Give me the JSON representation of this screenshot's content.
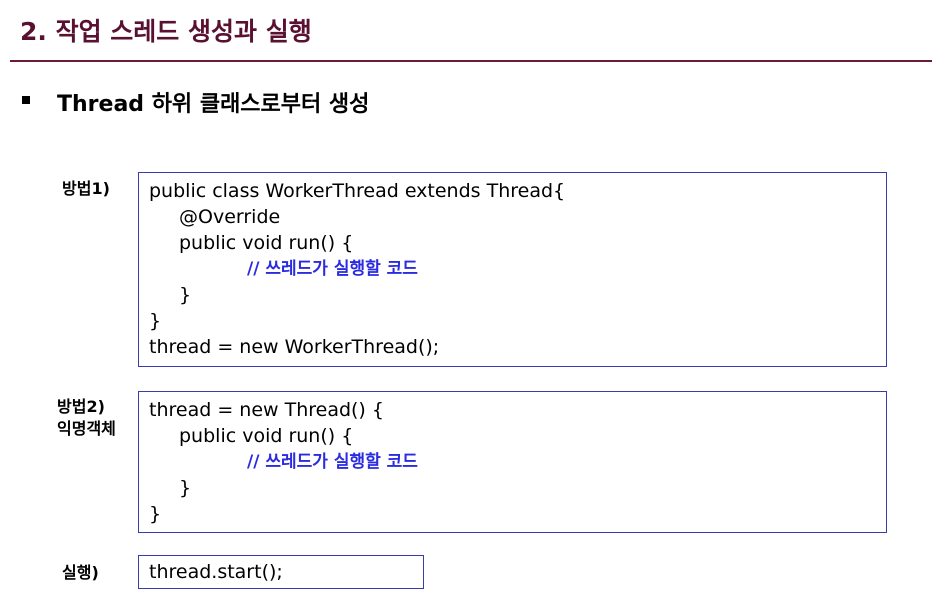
{
  "slide": {
    "title": "2. 작업 스레드 생성과 실행",
    "bullet": "Thread 하위 클래스로부터 생성"
  },
  "method1": {
    "label": "방법1)",
    "lines": [
      "public class WorkerThread extends Thread{",
      "@Override",
      "public void run() {",
      "// 쓰레드가 실행할 코드",
      "}",
      "}",
      "thread = new WorkerThread();"
    ]
  },
  "method2": {
    "label_line1": "방법2)",
    "label_line2": "익명객체",
    "lines": [
      "thread = new Thread() {",
      "public void run() {",
      "// 쓰레드가 실행할 코드",
      "}",
      "}"
    ]
  },
  "execute": {
    "label": "실행)",
    "line": "thread.start();"
  },
  "colors": {
    "title": "#5a1030",
    "rule": "#6b1a3a",
    "box_border": "#3b3bb0",
    "comment": "#2b2be0"
  }
}
